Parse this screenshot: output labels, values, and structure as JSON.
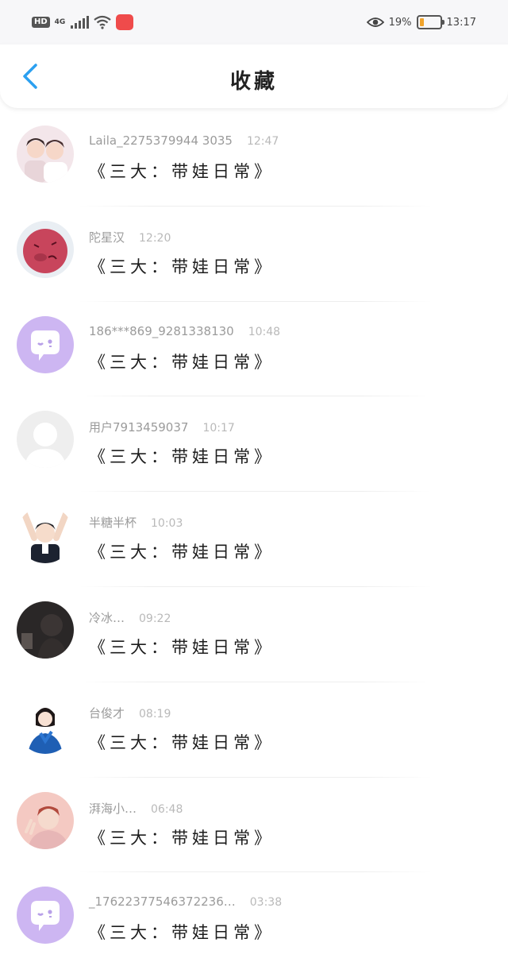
{
  "status_bar": {
    "hd": "HD",
    "network": "4G",
    "battery_percent": "19%",
    "time": "13:17",
    "battery_level": 0.19,
    "battery_color": "#f0a32c"
  },
  "header": {
    "title": "收藏",
    "back_icon": "chevron-left-icon",
    "accent_color": "#2ba0f0"
  },
  "items": [
    {
      "name": "Laila_2275379944 3035",
      "time": "12:47",
      "message": "《三大：带娃日常》",
      "avatar": "photo-two-people"
    },
    {
      "name": "陀星汉",
      "time": "12:20",
      "message": "《三大：带娃日常》",
      "avatar": "red-ball-character"
    },
    {
      "name": "186***869_9281338130",
      "time": "10:48",
      "message": "《三大：带娃日常》",
      "avatar": "default-chat-purple"
    },
    {
      "name": "用户7913459037",
      "time": "10:17",
      "message": "《三大：带娃日常》",
      "avatar": "default-gray-person"
    },
    {
      "name": "半糖半杯",
      "time": "10:03",
      "message": "《三大：带娃日常》",
      "avatar": "photo-person-hands-up"
    },
    {
      "name": "冷冰…",
      "time": "09:22",
      "message": "《三大：带娃日常》",
      "avatar": "photo-dark"
    },
    {
      "name": "台俊才",
      "time": "08:19",
      "message": "《三大：带娃日常》",
      "avatar": "photo-woman-blue-dress"
    },
    {
      "name": "湃海小…",
      "time": "06:48",
      "message": "《三大：带娃日常》",
      "avatar": "photo-person-pink"
    },
    {
      "name": "_17622377546372236…",
      "time": "03:38",
      "message": "《三大：带娃日常》",
      "avatar": "default-chat-purple"
    }
  ]
}
